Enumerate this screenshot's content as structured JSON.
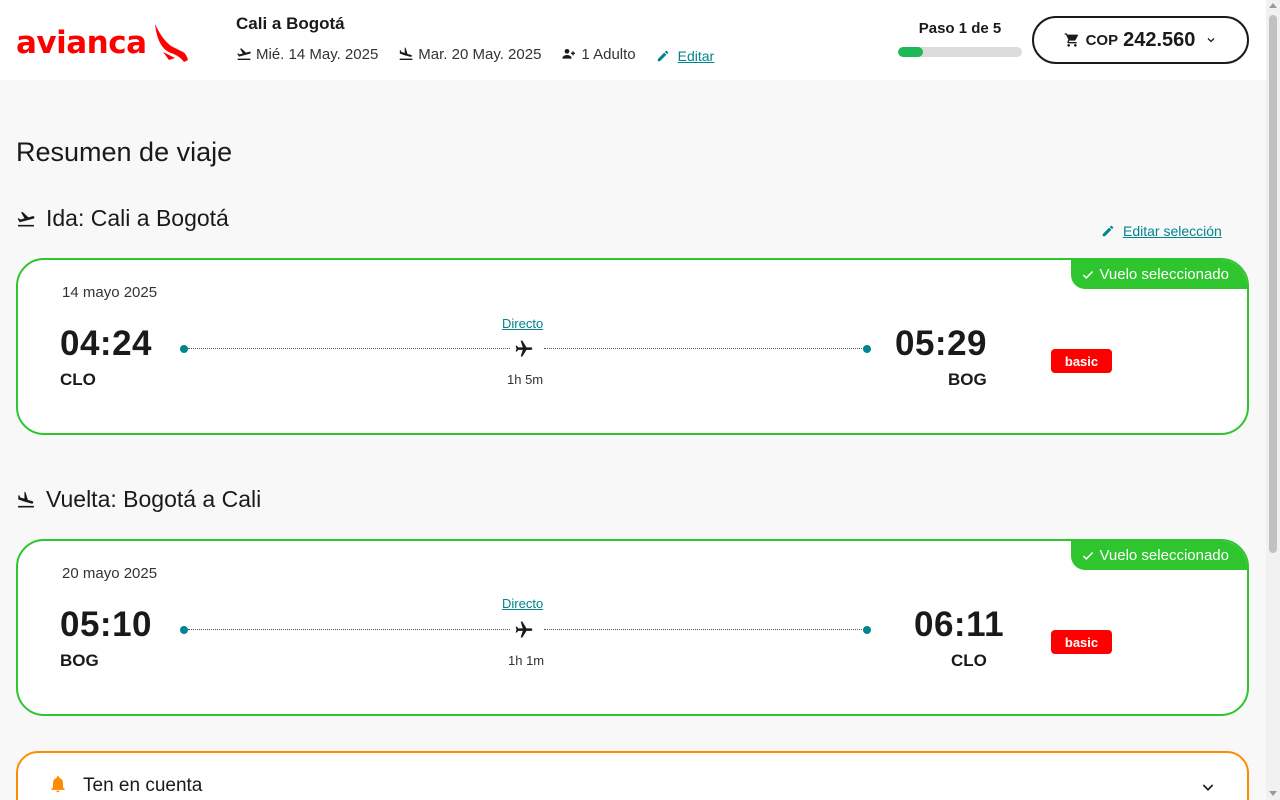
{
  "header": {
    "logo_text": "avianca",
    "trip_title": "Cali a Bogotá",
    "outbound_date": "Mié. 14 May. 2025",
    "return_date": "Mar. 20 May. 2025",
    "passengers": "1 Adulto",
    "edit_label": "Editar",
    "step_label": "Paso 1 de 5",
    "step_progress_fraction": 0.2,
    "cart_currency": "COP",
    "cart_amount": "242.560"
  },
  "main": {
    "page_title": "Resumen de viaje",
    "edit_selection_label": "Editar selección",
    "outbound": {
      "heading": "Ida: Cali a Bogotá",
      "selected_label": "Vuelo seleccionado",
      "date": "14 mayo 2025",
      "depart_time": "04:24",
      "depart_code": "CLO",
      "arrive_time": "05:29",
      "arrive_code": "BOG",
      "stops_label": "Directo",
      "duration": "1h 5m",
      "fare": "basic"
    },
    "return": {
      "heading": "Vuelta: Bogotá a Cali",
      "selected_label": "Vuelo seleccionado",
      "date": "20 mayo 2025",
      "depart_time": "05:10",
      "depart_code": "BOG",
      "arrive_time": "06:11",
      "arrive_code": "CLO",
      "stops_label": "Directo",
      "duration": "1h 1m",
      "fare": "basic"
    },
    "notice": {
      "title": "Ten en cuenta"
    }
  },
  "colors": {
    "brand_red": "#ff0000",
    "link_teal": "#00848e",
    "selected_green": "#2ec52e",
    "notice_orange": "#ff8c00"
  },
  "icons": {
    "takeoff": "flight-takeoff-icon",
    "landing": "flight-land-icon",
    "passengers": "group-icon",
    "edit": "pencil-icon",
    "cart": "cart-icon",
    "check": "check-icon",
    "plane": "plane-icon",
    "bell": "bell-icon",
    "chevron": "chevron-down-icon"
  }
}
